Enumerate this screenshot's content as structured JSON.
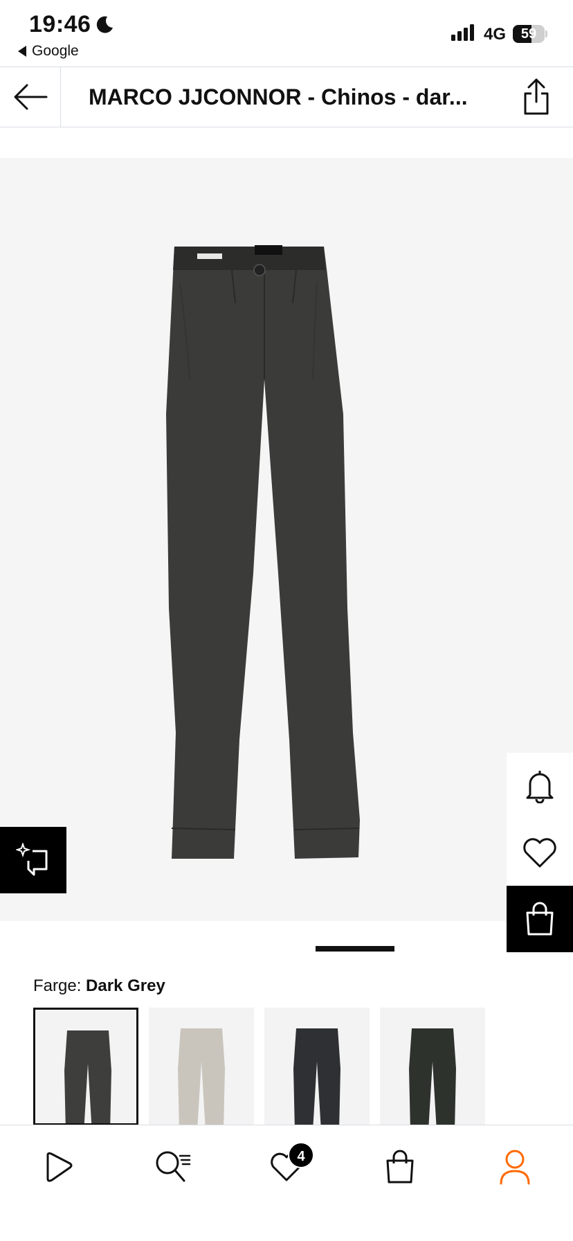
{
  "status_bar": {
    "time": "19:46",
    "back_app": "Google",
    "network": "4G",
    "battery_level": "59",
    "battery_fraction": 0.59
  },
  "header": {
    "title": "MARCO JJCONNOR - Chinos - dar..."
  },
  "product": {
    "image_icon": "trousers-dark-grey",
    "gallery_page_indicator": "1"
  },
  "color": {
    "label": "Farge:",
    "value": "Dark Grey",
    "swatches": [
      {
        "color": "#3e3f3d",
        "selected": true
      },
      {
        "color": "#c9c5bd",
        "selected": false
      },
      {
        "color": "#2f3033",
        "selected": false
      },
      {
        "color": "#2d322d",
        "selected": false
      }
    ]
  },
  "bottom_nav": {
    "items": [
      "home-icon",
      "search-icon",
      "wishlist-icon",
      "bag-icon",
      "profile-icon"
    ],
    "wishlist_count": "4",
    "active_color": "#ff6900"
  }
}
